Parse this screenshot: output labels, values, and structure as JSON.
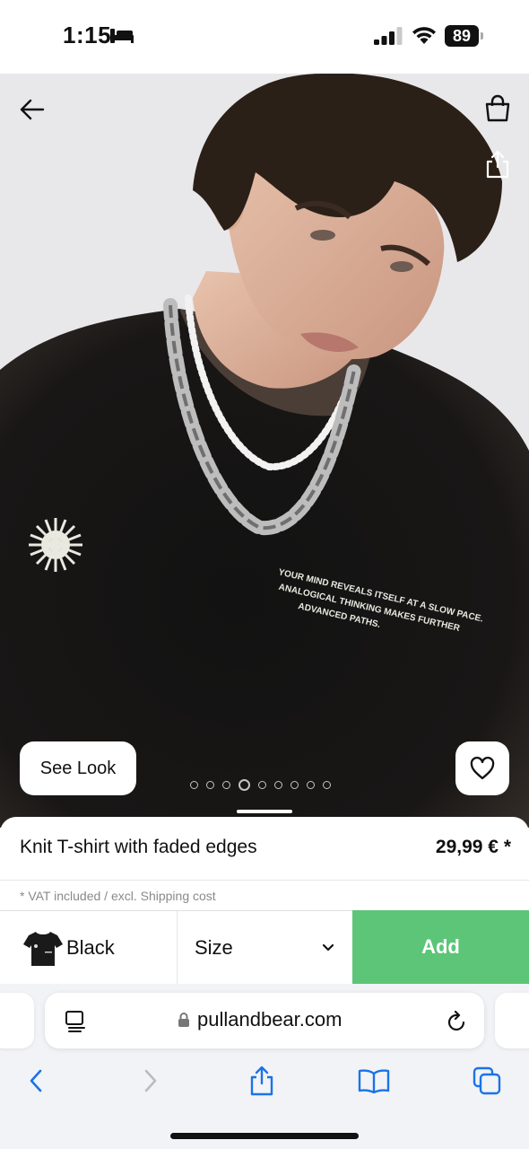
{
  "status_bar": {
    "time": "1:15",
    "battery": "89"
  },
  "product": {
    "name": "Knit T-shirt with faded edges",
    "price": "29,99 € *",
    "vat_note": "* VAT included / excl. Shipping cost",
    "color": "Black",
    "size_label": "Size",
    "add_label": "Add"
  },
  "gallery": {
    "see_look_label": "See Look",
    "image_count": 9,
    "active_index": 3,
    "print_text": [
      "YOUR MIND REVEALS ITSELF AT A SLOW PACE.",
      "ANALOGICAL THINKING MAKES FURTHER",
      "ADVANCED PATHS."
    ]
  },
  "browser": {
    "url": "pullandbear.com"
  },
  "colors": {
    "add_button": "#5dc577",
    "safari_accent": "#1a73e8"
  },
  "icons": [
    "back-arrow-icon",
    "shopping-bag-icon",
    "share-icon",
    "heart-icon",
    "reader-icon",
    "lock-icon",
    "reload-icon",
    "back-icon",
    "forward-icon",
    "share-icon",
    "bookmarks-icon",
    "tabs-icon"
  ]
}
